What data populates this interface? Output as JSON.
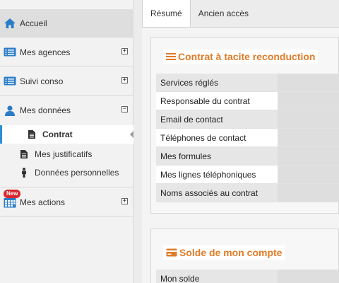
{
  "sidebar": {
    "items": [
      {
        "label": "Accueil",
        "icon": "home-icon"
      },
      {
        "label": "Mes agences",
        "icon": "list-card-icon",
        "toggle": "+"
      },
      {
        "label": "Suivi conso",
        "icon": "list-card-icon",
        "toggle": "+"
      },
      {
        "label": "Mes données",
        "icon": "user-icon",
        "toggle": "−"
      },
      {
        "label": "Mes actions",
        "icon": "calendar-icon",
        "toggle": "+",
        "badge": "New"
      }
    ],
    "subitems": [
      {
        "label": "Contrat",
        "icon": "file-icon"
      },
      {
        "label": "Mes justificatifs",
        "icon": "file-icon"
      },
      {
        "label": "Données personnelles",
        "icon": "person-icon"
      }
    ]
  },
  "tabs": [
    {
      "label": "Résumé"
    },
    {
      "label": "Ancien accès"
    }
  ],
  "contract_panel": {
    "title": "Contrat à tacite reconduction",
    "rows": [
      "Services réglés",
      "Responsable du contrat",
      "Email de contact",
      "Téléphones de contact",
      "Mes formules",
      "Mes lignes téléphoniques",
      "Noms associés au contrat"
    ]
  },
  "balance_panel": {
    "title": "Solde de mon compte",
    "rows": [
      "Mon solde"
    ]
  },
  "colors": {
    "accent_orange": "#e07b28",
    "selection_blue": "#2a8fd8",
    "icon_blue": "#2a7cc7",
    "badge_red": "#d9262d"
  }
}
